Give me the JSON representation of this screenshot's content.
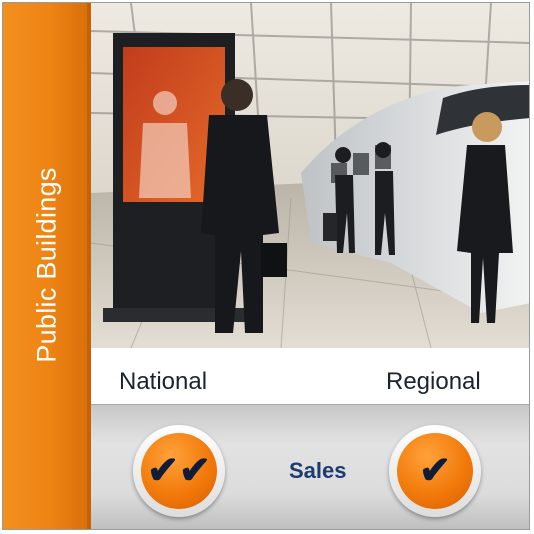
{
  "side_tab": {
    "label": "Public Buildings"
  },
  "columns": {
    "national_label": "National",
    "regional_label": "Regional"
  },
  "sales": {
    "label": "Sales",
    "national_mark": "✔✔",
    "regional_mark": "✔",
    "national_mark_icon": "double-check-icon",
    "regional_mark_icon": "check-icon"
  },
  "colors": {
    "accent_orange": "#ee8414",
    "sales_text": "#1d3b70",
    "check_dark": "#0f1d3a"
  }
}
